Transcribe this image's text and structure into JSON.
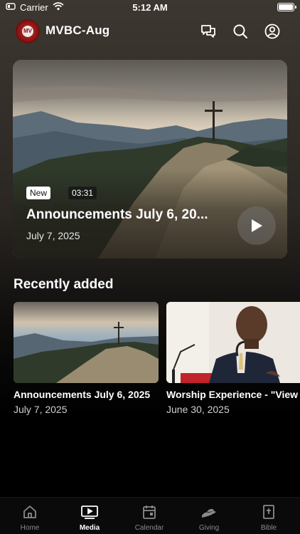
{
  "status_bar": {
    "carrier": "Carrier",
    "time": "5:12 AM"
  },
  "header": {
    "title": "MVBC-Aug",
    "logo_text": "MV"
  },
  "featured": {
    "badge_new": "New",
    "duration": "03:31",
    "title": "Announcements July  6, 20...",
    "date": "July 7, 2025"
  },
  "recently_added": {
    "heading": "Recently added",
    "items": [
      {
        "title": "Announcements July  6, 2025",
        "date": "July 7, 2025"
      },
      {
        "title": "Worship Experience - \"View",
        "date": "June 30, 2025"
      }
    ]
  },
  "tabs": [
    {
      "label": "Home",
      "icon": "home-icon",
      "active": false
    },
    {
      "label": "Media",
      "icon": "play-screen-icon",
      "active": true
    },
    {
      "label": "Calendar",
      "icon": "calendar-icon",
      "active": false
    },
    {
      "label": "Giving",
      "icon": "giving-hand-icon",
      "active": false
    },
    {
      "label": "Bible",
      "icon": "bible-icon",
      "active": false
    }
  ]
}
